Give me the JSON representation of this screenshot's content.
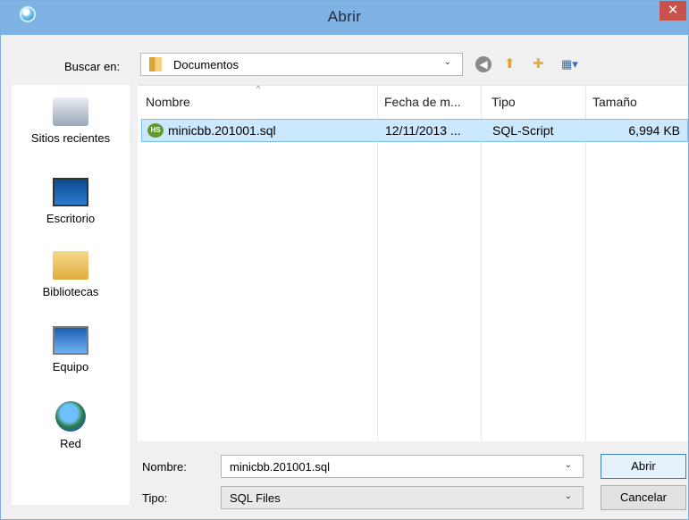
{
  "window": {
    "title": "Abrir",
    "close_glyph": "✕"
  },
  "lookin": {
    "label": "Buscar en:",
    "value": "Documentos",
    "arrow": "⌄"
  },
  "toolbar": {
    "back_glyph": "◀",
    "up_glyph": "⬆",
    "new_folder_glyph": "✚",
    "view_glyph": "▦▾"
  },
  "places": [
    {
      "label": "Sitios recientes",
      "icon": "recent-places-icon"
    },
    {
      "label": "Escritorio",
      "icon": "desktop-icon"
    },
    {
      "label": "Bibliotecas",
      "icon": "libraries-icon"
    },
    {
      "label": "Equipo",
      "icon": "computer-icon"
    },
    {
      "label": "Red",
      "icon": "network-icon"
    }
  ],
  "columns": [
    "Nombre",
    "Fecha de m...",
    "Tipo",
    "Tamaño"
  ],
  "sort_glyph": "^",
  "files": [
    {
      "name": "minicbb.201001.sql",
      "date": "12/11/2013 ...",
      "type": "SQL-Script",
      "size": "6,994 KB",
      "icon_text": "HS",
      "selected": true
    }
  ],
  "filename": {
    "label": "Nombre:",
    "value": "minicbb.201001.sql",
    "arrow": "⌄"
  },
  "filetype": {
    "label": "Tipo:",
    "value": "SQL Files",
    "arrow": "⌄"
  },
  "buttons": {
    "open": "Abrir",
    "cancel": "Cancelar"
  },
  "colors": {
    "titlebar": "#7fb3e3",
    "selection": "#cce8ff",
    "close": "#c8514b"
  }
}
